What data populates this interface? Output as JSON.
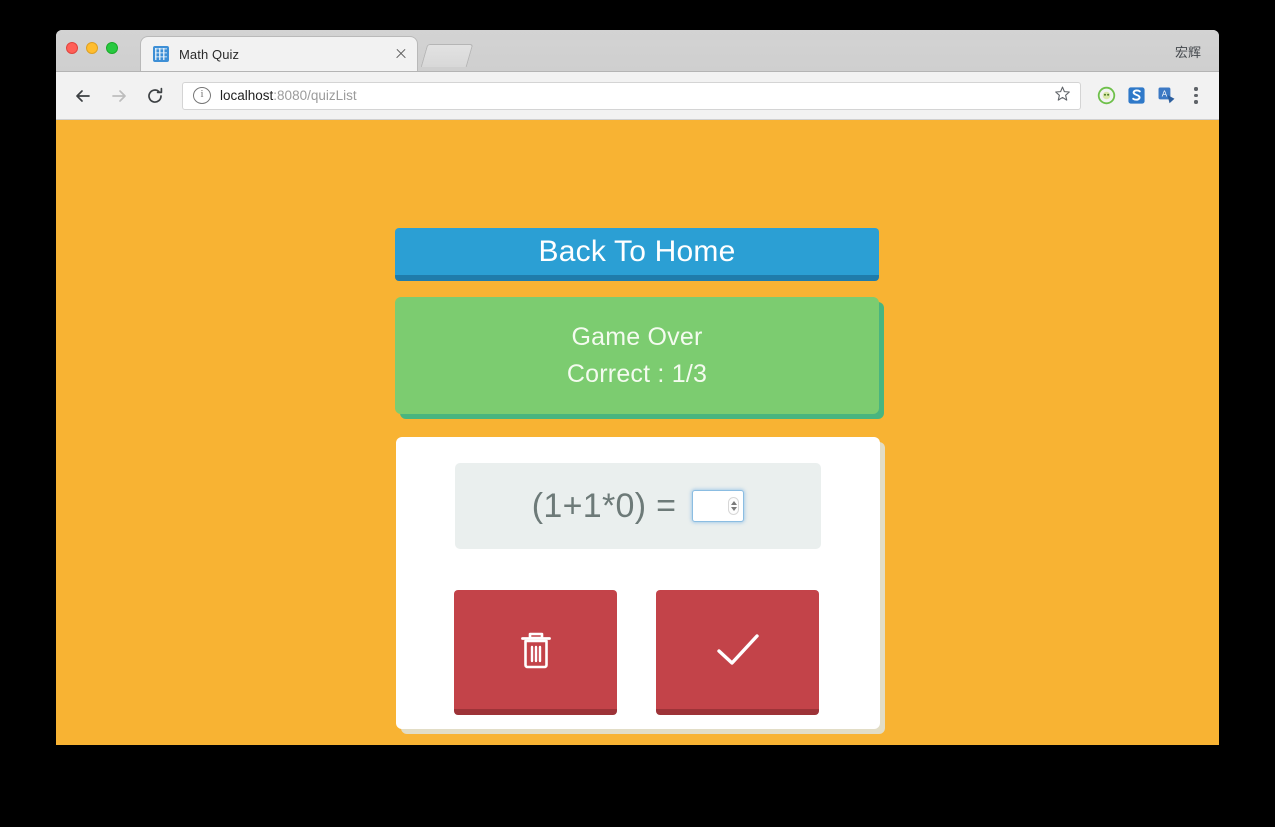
{
  "browser": {
    "tab": {
      "title": "Math Quiz",
      "favicon": "math-quiz-favicon",
      "close_icon": "close-icon"
    },
    "new_tab_label": "new-tab-button",
    "profile_name": "宏辉",
    "toolbar": {
      "back_icon": "back-arrow-icon",
      "forward_icon": "forward-arrow-icon",
      "reload_icon": "reload-icon",
      "page_info_icon": "page-info-icon",
      "url_host": "localhost",
      "url_path": ":8080/quizList",
      "bookmark_icon": "star-icon",
      "extensions": [
        "extension-icon-green",
        "extension-icon-sogou",
        "extension-icon-translate"
      ],
      "menu_icon": "three-dot-menu-icon"
    }
  },
  "page": {
    "background_color": "#f8b333",
    "back_to_home": {
      "label": "Back To Home",
      "color": "#2b9fd4",
      "shadow_color": "#1f7cab"
    },
    "status_panel": {
      "title": "Game Over",
      "score": "Correct : 1/3",
      "color": "#7ccc70",
      "shadow_color": "#49b57f"
    },
    "quiz_card": {
      "question": "(1+1*0) =",
      "answer_value": "",
      "answer_placeholder": "",
      "buttons": [
        {
          "name": "delete-button",
          "icon": "trash-icon",
          "color": "#c34349",
          "shadow_color": "#9d3338"
        },
        {
          "name": "submit-button",
          "icon": "check-icon",
          "color": "#c34349",
          "shadow_color": "#9d3338"
        }
      ]
    }
  }
}
